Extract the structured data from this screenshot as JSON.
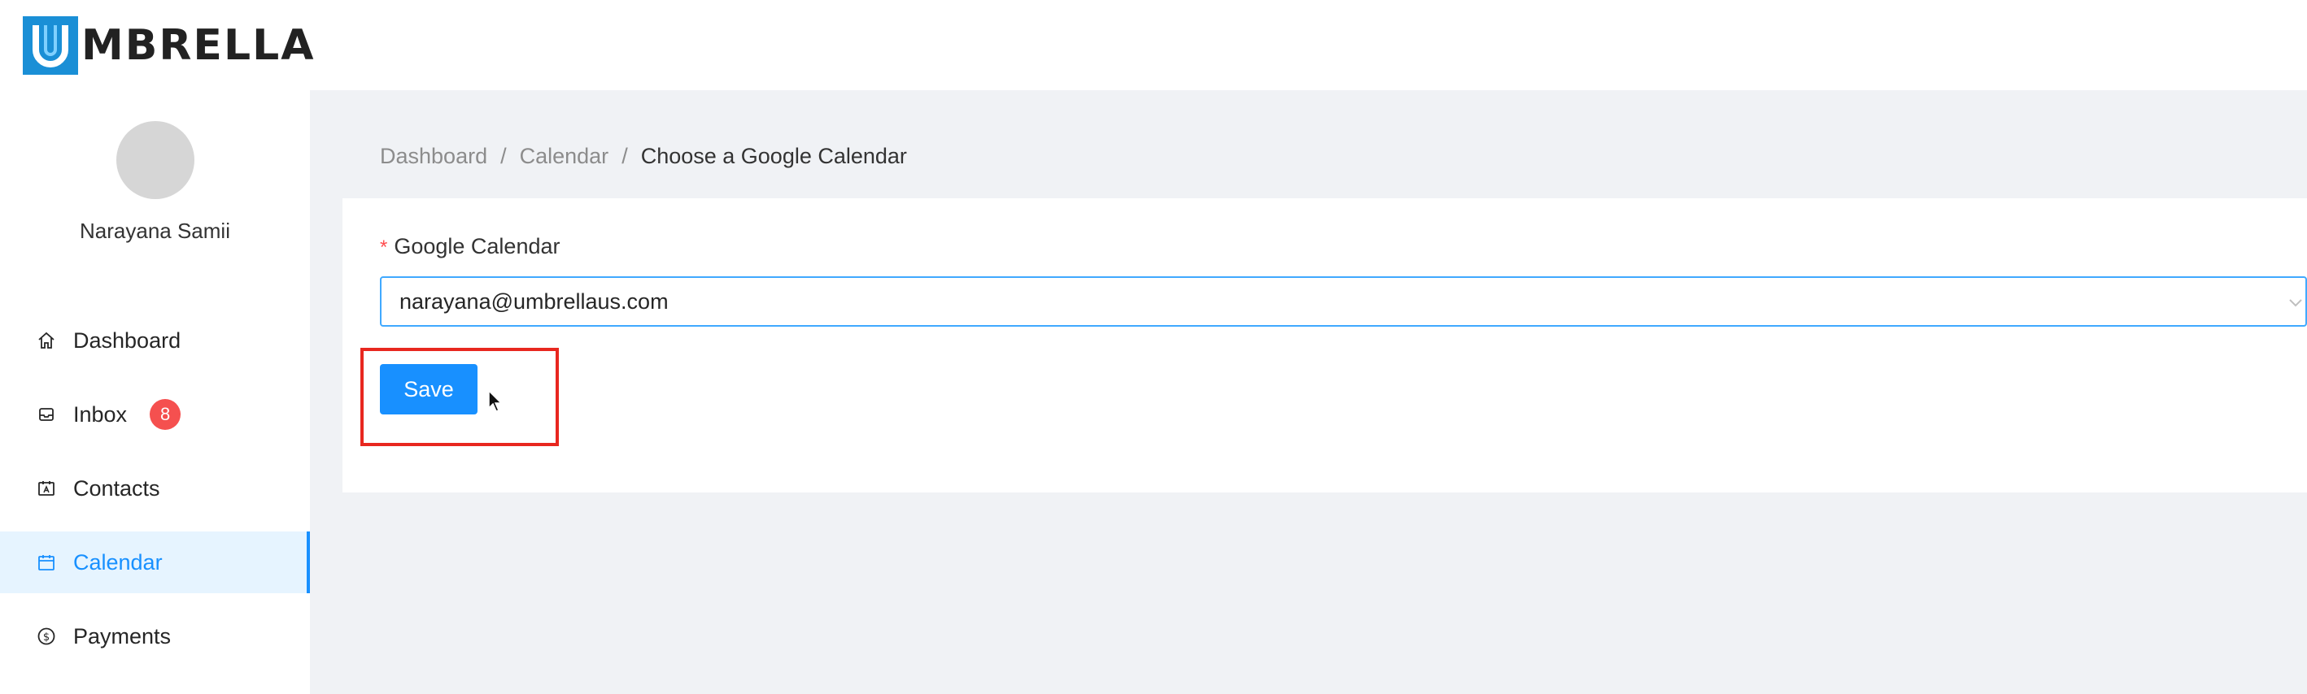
{
  "header": {
    "logo_text": "MBRELLA",
    "logo_mark": "U"
  },
  "sidebar": {
    "user_name": "Narayana Samii",
    "items": [
      {
        "label": "Dashboard",
        "icon": "home-icon"
      },
      {
        "label": "Inbox",
        "icon": "inbox-icon",
        "badge": "8"
      },
      {
        "label": "Contacts",
        "icon": "contacts-icon"
      },
      {
        "label": "Calendar",
        "icon": "calendar-icon",
        "active": true
      },
      {
        "label": "Payments",
        "icon": "dollar-icon"
      }
    ]
  },
  "breadcrumb": {
    "items": [
      "Dashboard",
      "Calendar",
      "Choose a Google Calendar"
    ],
    "separator": "/"
  },
  "form": {
    "required_mark": "*",
    "label": "Google Calendar",
    "selected_value": "narayana@umbrellaus.com",
    "save_label": "Save"
  },
  "colors": {
    "accent": "#1890ff",
    "badge": "#f5504f",
    "highlight": "#e8271f",
    "logo": "#1a8fd6"
  }
}
